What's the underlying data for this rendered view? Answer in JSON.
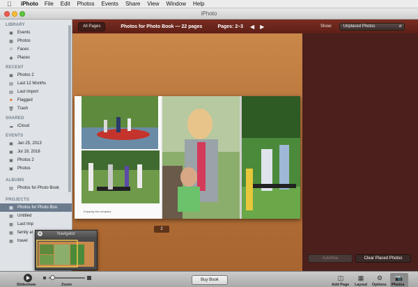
{
  "menubar": {
    "app": "iPhoto",
    "items": [
      "File",
      "Edit",
      "Photos",
      "Events",
      "Share",
      "View",
      "Window",
      "Help"
    ]
  },
  "window": {
    "title": "iPhoto"
  },
  "sidebar": {
    "library_header": "LIBRARY",
    "library": [
      "Events",
      "Photos",
      "Faces",
      "Places"
    ],
    "recent_header": "RECENT",
    "recent": [
      "Photos 2",
      "Last 12 Months",
      "Last Import",
      "Flagged",
      "Trash"
    ],
    "shared_header": "SHARED",
    "shared": [
      "iCloud"
    ],
    "events_header": "EVENTS",
    "events": [
      "Jan 25, 2013",
      "Jul 19, 2018",
      "Photos 2",
      "Photos"
    ],
    "albums_header": "ALBUMS",
    "albums": [
      "Photos for Photo Book"
    ],
    "projects_header": "PROJECTS",
    "projects": [
      "Photos for Photo Boo",
      "Untitled",
      "Last Imp",
      "family al",
      "travel"
    ]
  },
  "toolbar": {
    "all_pages": "All Pages",
    "book_title": "Photos for Photo Book — 22 pages",
    "pages_range": "Pages: 2–3"
  },
  "right_panel": {
    "show_label": "Show:",
    "show_value": "Unplaced Photos",
    "autoflow": "Autoflow",
    "clear_placed": "Clear Placed Photos"
  },
  "canvas": {
    "caption": "Enjoying the company",
    "page_number": "2"
  },
  "navigator": {
    "title": "Navigator"
  },
  "bottom": {
    "slideshow": "Slideshow",
    "zoom": "Zoom",
    "buy_book": "Buy Book",
    "add_page": "Add Page",
    "layout": "Layout",
    "options": "Options",
    "photos": "Photos"
  },
  "colors": {
    "toolbar": "#6b2519",
    "canvas_wood": "#b8743b",
    "sidebar": "#dfe3e8",
    "selection": "#6c7b8d",
    "right_panel": "#4a1f1c"
  }
}
